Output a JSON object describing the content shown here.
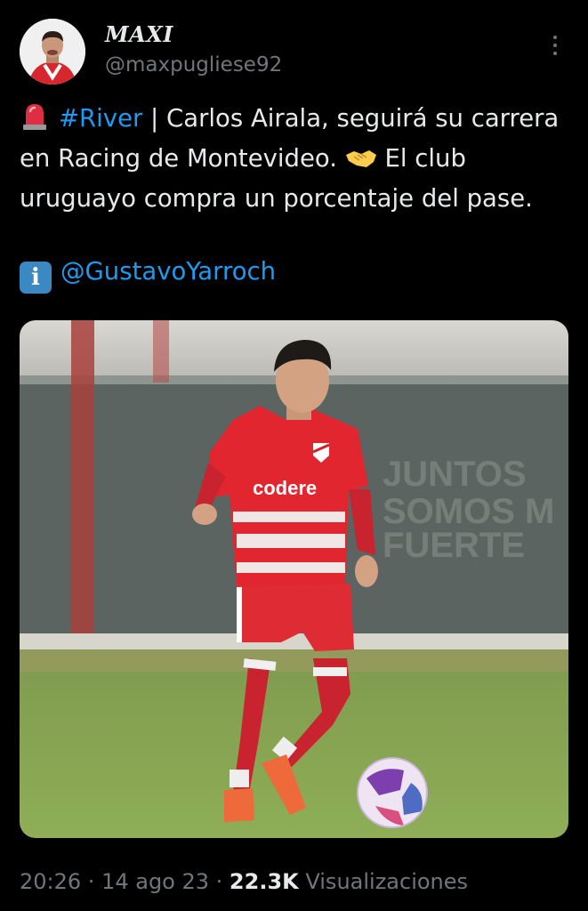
{
  "author": {
    "display_name": "MAXI",
    "handle": "@maxpugliese92"
  },
  "tweet": {
    "hashtag": "#River",
    "separator": " | ",
    "line_text_1": "Carlos Airala, seguirá su carrera en Racing de Montevideo.",
    "line_text_2": " El club uruguayo compra un porcentaje del pase.",
    "mention": "@GustavoYarroch"
  },
  "image": {
    "shirt_sponsor": "codere",
    "banner_lines": [
      "JUNTOS",
      "SOMOS M",
      "FUERTE"
    ]
  },
  "meta": {
    "time": "20:26",
    "date": "14 ago 23",
    "views_count": "22.3K",
    "views_label": "Visualizaciones",
    "dot": " · "
  },
  "icons": {
    "alarm": "rotating-light-emoji",
    "handshake": "handshake-emoji",
    "info": "information-emoji",
    "more": "more-options-icon"
  },
  "colors": {
    "background": "#000000",
    "link": "#1d9bf0",
    "secondary_text": "#71767b",
    "primary_text": "#e7e9ea"
  }
}
